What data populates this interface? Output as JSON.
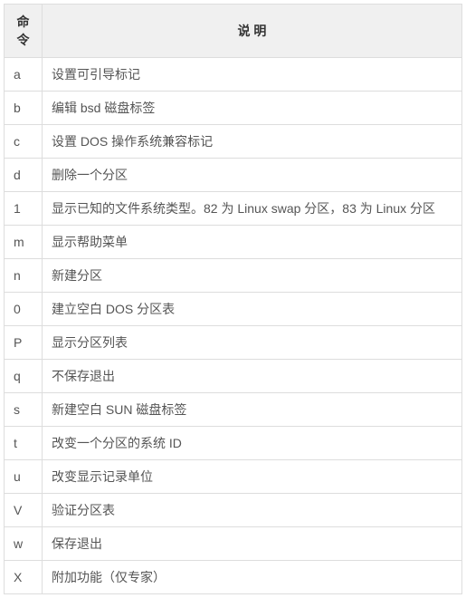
{
  "table": {
    "headers": {
      "command": "命令",
      "description": "说 明"
    },
    "rows": [
      {
        "cmd": "a",
        "desc": "设置可引导标记"
      },
      {
        "cmd": "b",
        "desc": "编辑 bsd 磁盘标签"
      },
      {
        "cmd": "c",
        "desc": "设置 DOS 操作系统兼容标记"
      },
      {
        "cmd": "d",
        "desc": "删除一个分区"
      },
      {
        "cmd": "1",
        "desc": "显示已知的文件系统类型。82 为 Linux swap 分区，83 为 Linux 分区"
      },
      {
        "cmd": "m",
        "desc": "显示帮助菜单"
      },
      {
        "cmd": "n",
        "desc": "新建分区"
      },
      {
        "cmd": "0",
        "desc": "建立空白 DOS 分区表"
      },
      {
        "cmd": "P",
        "desc": "显示分区列表"
      },
      {
        "cmd": "q",
        "desc": "不保存退出"
      },
      {
        "cmd": "s",
        "desc": "新建空白 SUN 磁盘标签"
      },
      {
        "cmd": "t",
        "desc": "改变一个分区的系统 ID"
      },
      {
        "cmd": "u",
        "desc": "改变显示记录单位"
      },
      {
        "cmd": "V",
        "desc": "验证分区表"
      },
      {
        "cmd": "w",
        "desc": "保存退出"
      },
      {
        "cmd": "X",
        "desc": "附加功能（仅专家）"
      }
    ]
  }
}
